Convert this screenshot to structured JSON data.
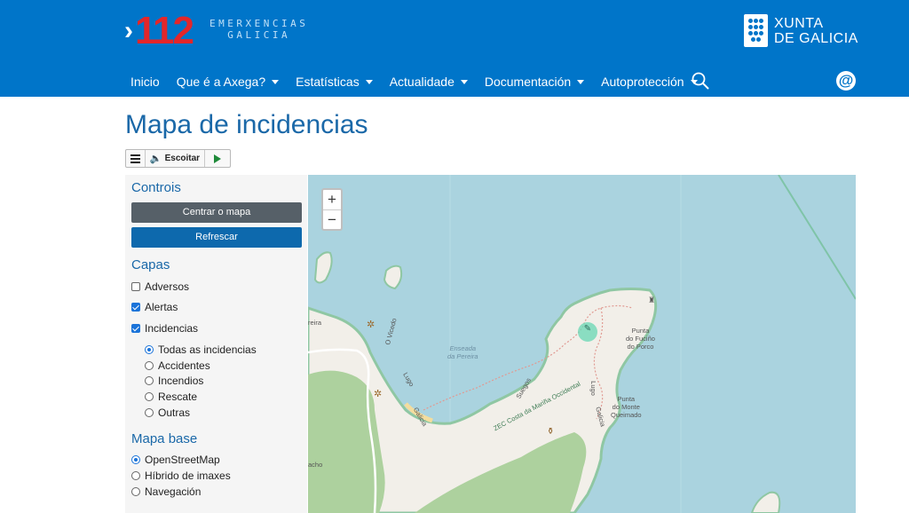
{
  "header": {
    "logo_number": "112",
    "logo_line1": "EMERXENCIAS",
    "logo_line2": "GALICIA",
    "xunta_line1": "XUNTA",
    "xunta_line2": "DE GALICIA",
    "background_color": "#0075c9"
  },
  "nav": {
    "items": [
      {
        "label": "Inicio",
        "dropdown": false
      },
      {
        "label": "Que é a Axega?",
        "dropdown": true
      },
      {
        "label": "Estatísticas",
        "dropdown": true
      },
      {
        "label": "Actualidade",
        "dropdown": true
      },
      {
        "label": "Documentación",
        "dropdown": true
      },
      {
        "label": "Autoprotección",
        "dropdown": true
      }
    ],
    "search_icon": "search-icon",
    "contact_icon": "at-icon"
  },
  "page": {
    "title": "Mapa de incidencias"
  },
  "reader": {
    "listen_label": "Escoitar"
  },
  "sidebar": {
    "controls_title": "Controis",
    "center_button": "Centrar o mapa",
    "refresh_button": "Refrescar",
    "layers_title": "Capas",
    "layers": [
      {
        "label": "Adversos",
        "checked": false
      },
      {
        "label": "Alertas",
        "checked": true
      },
      {
        "label": "Incidencias",
        "checked": true
      }
    ],
    "incident_filters": [
      {
        "label": "Todas as incidencias",
        "selected": true
      },
      {
        "label": "Accidentes",
        "selected": false
      },
      {
        "label": "Incendios",
        "selected": false
      },
      {
        "label": "Rescate",
        "selected": false
      },
      {
        "label": "Outras",
        "selected": false
      }
    ],
    "basemap_title": "Mapa base",
    "basemaps": [
      {
        "label": "OpenStreetMap",
        "selected": true
      },
      {
        "label": "Híbrido de imaxes",
        "selected": false
      },
      {
        "label": "Navegación",
        "selected": false
      }
    ]
  },
  "map": {
    "zoom_in": "+",
    "zoom_out": "−",
    "labels": {
      "enseada": "Enseada\nda Pereira",
      "punta_porco": "Punta\ndo Fuciño\ndo Porco",
      "punta_monte": "Punta\ndo Monte\nQueimado",
      "vicedo": "O Vicedo",
      "lugo1": "Lugo",
      "lugo2": "Lugo",
      "galicia1": "Galicia",
      "galicia2": "Galicia",
      "suegos": "Suegos",
      "zec": "ZEC Costa da Mariña Occidental",
      "reira": "reira",
      "acho": "acho"
    },
    "colors": {
      "sea": "#aad3df",
      "land": "#f2efe9",
      "forest": "#a8d5a0",
      "path": "#e8a09a"
    }
  }
}
